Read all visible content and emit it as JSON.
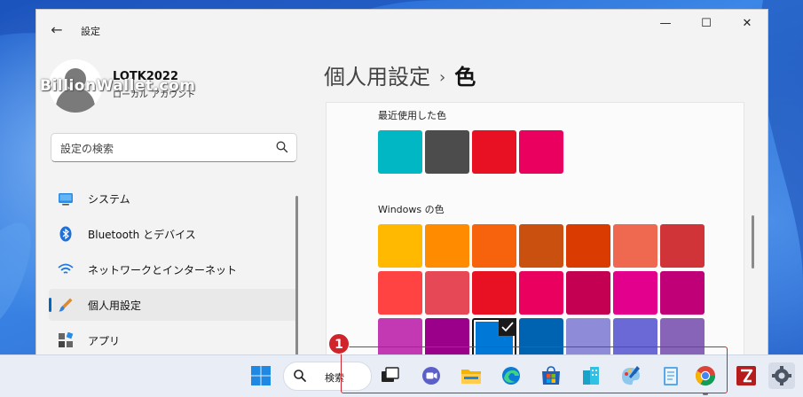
{
  "window": {
    "app_title": "設定",
    "back_icon": "←",
    "minimize_icon": "—",
    "maximize_icon": "☐",
    "close_icon": "✕"
  },
  "profile": {
    "user_name": "LOTK2022",
    "account_type": "ローカル アカウント",
    "watermark": "BillionWallet.com"
  },
  "search": {
    "placeholder": "設定の検索"
  },
  "nav": {
    "items": [
      {
        "label": "システム",
        "icon": "monitor-icon"
      },
      {
        "label": "Bluetooth とデバイス",
        "icon": "bluetooth-icon"
      },
      {
        "label": "ネットワークとインターネット",
        "icon": "wifi-icon"
      },
      {
        "label": "個人用設定",
        "icon": "brush-icon",
        "selected": true
      },
      {
        "label": "アプリ",
        "icon": "apps-icon"
      }
    ]
  },
  "breadcrumb": {
    "parent": "個人用設定",
    "separator": "›",
    "current": "色"
  },
  "colors": {
    "recent_label": "最近使用した色",
    "recent": [
      "#00b7c3",
      "#4c4c4c",
      "#e81123",
      "#ea005e"
    ],
    "windows_label": "Windows の色",
    "windows_rows": [
      [
        "#ffb900",
        "#ff8c00",
        "#f7630c",
        "#ca5010",
        "#da3b01",
        "#ef6950",
        "#d13438"
      ],
      [
        "#ff4343",
        "#e74856",
        "#e81123",
        "#ea005e",
        "#c30052",
        "#e3008c",
        "#bf0077"
      ],
      [
        "#c239b3",
        "#9a0089",
        "#0078d7",
        "#0063b1",
        "#8e8cd8",
        "#6b69d6",
        "#8764b8"
      ]
    ],
    "selected_row": 2,
    "selected_col": 2
  },
  "taskbar": {
    "search_label": "検索",
    "apps": [
      "start-icon",
      "task-view-icon",
      "chat-icon",
      "file-explorer-icon",
      "edge-icon",
      "store-icon",
      "network-app-icon",
      "paint-icon",
      "notepad-icon",
      "chrome-icon",
      "filezilla-icon",
      "settings-icon"
    ]
  },
  "annotation": {
    "badge": "1",
    "color": "#d0242c"
  }
}
